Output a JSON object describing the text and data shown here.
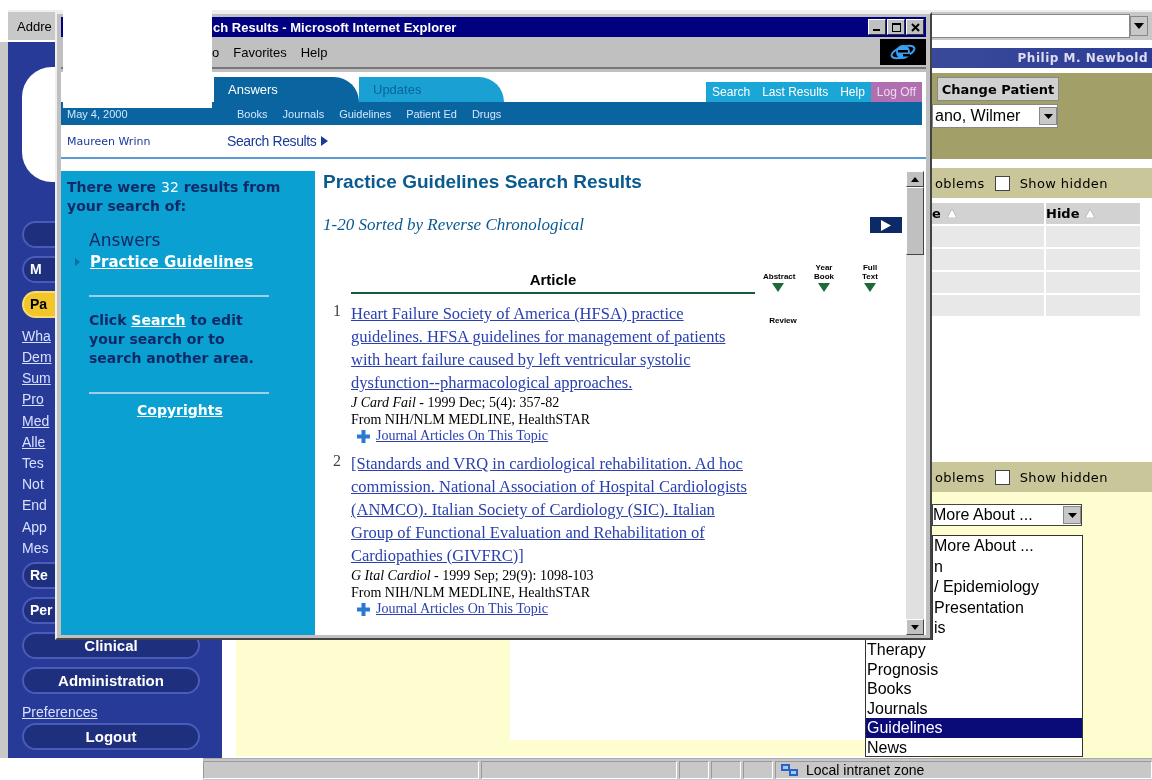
{
  "address_bar": {
    "label": "Addre"
  },
  "sidebar": {
    "items": [
      {
        "kind": "cut-button",
        "selected": false
      },
      {
        "kind": "cut-button",
        "label": "M",
        "selected": false
      },
      {
        "kind": "cut-button",
        "label": "Pa",
        "selected": true
      },
      {
        "kind": "link",
        "label": "Wha"
      },
      {
        "kind": "link",
        "label": "Dem"
      },
      {
        "kind": "link",
        "label": "Sum"
      },
      {
        "kind": "link",
        "label": "Pro"
      },
      {
        "kind": "link",
        "label": "Med"
      },
      {
        "kind": "link",
        "label": "Alle"
      },
      {
        "kind": "text",
        "label": "Tes"
      },
      {
        "kind": "text",
        "label": "Not"
      },
      {
        "kind": "text",
        "label": "End"
      },
      {
        "kind": "text",
        "label": "App"
      },
      {
        "kind": "text",
        "label": "Mes"
      },
      {
        "kind": "cut-button",
        "label": "Re",
        "selected": false
      },
      {
        "kind": "cut-button",
        "label": "Per",
        "selected": false
      },
      {
        "kind": "button",
        "label": "Clinical",
        "selected": false
      },
      {
        "kind": "button",
        "label": "Administration",
        "selected": false
      },
      {
        "kind": "link",
        "label": "Preferences"
      },
      {
        "kind": "button",
        "label": "Logout",
        "selected": false
      }
    ]
  },
  "header": {
    "user": "Philip M. Newbold",
    "change_patient": "Change Patient",
    "patient": "ano, Wilmer"
  },
  "problems_top": {
    "label": "oblems",
    "show_hidden": {
      "label": "Show hidden",
      "checked": false
    },
    "columns": [
      {
        "label": "e"
      },
      {
        "label": "Hide"
      }
    ],
    "row_count_rows": [
      {},
      {},
      {},
      {}
    ]
  },
  "problems_bottom": {
    "label": "oblems",
    "show_hidden": {
      "label": "Show hidden",
      "checked": false
    },
    "select": "More About ...",
    "list_beside_window": [
      {
        "label": "More About ...",
        "selected": false
      },
      {
        "label": "n",
        "selected": false
      },
      {
        "label": "/ Epidemiology",
        "selected": false
      },
      {
        "label": "Presentation",
        "selected": false
      },
      {
        "label": "is",
        "selected": false
      }
    ],
    "list": [
      {
        "label": "Therapy",
        "selected": false
      },
      {
        "label": "Prognosis",
        "selected": false
      },
      {
        "label": "Books",
        "selected": false
      },
      {
        "label": "Journals",
        "selected": false
      },
      {
        "label": "Guidelines",
        "selected": true
      },
      {
        "label": "News",
        "selected": false
      }
    ]
  },
  "status_bar": {
    "zone": "Local intranet zone"
  },
  "ie_window": {
    "title": "ch Results - Microsoft Internet Explorer",
    "menu": [
      "o",
      "Favorites",
      "Help"
    ],
    "tabs": [
      {
        "label": "Answers",
        "selected": true
      },
      {
        "label": "Updates",
        "selected": false
      }
    ],
    "nav": [
      {
        "label": "Search",
        "kind": "normal"
      },
      {
        "label": "Last Results",
        "kind": "normal"
      },
      {
        "label": "Help",
        "kind": "normal"
      },
      {
        "label": "Log Off",
        "kind": "logoff"
      }
    ],
    "date": "May 4, 2000",
    "sections": [
      "Books",
      "Journals",
      "Guidelines",
      "Patient Ed",
      "Drugs"
    ],
    "user": "Maureen Wrinn",
    "breadcrumb": "Search Results",
    "summary": {
      "prefix": "There were",
      "count": "32",
      "suffix": "results from your search of:"
    },
    "area": "Answers",
    "area_link": "Practice Guidelines",
    "hint": {
      "before": "Click",
      "link": "Search",
      "after": "to edit your search or to search another area."
    },
    "copyrights": "Copyrights",
    "heading": "Practice Guidelines Search Results",
    "sort": "1-20 Sorted by Reverse Chronological",
    "column": "Article",
    "icon_columns": [
      "Abstract",
      "Year Book",
      "Full Text"
    ],
    "results": [
      {
        "number": "1",
        "title": "Heart Failure Society of America (HFSA) practice guidelines. HFSA guidelines for management of patients with heart failure caused by left ventricular systolic dysfunction--pharmacological approaches.",
        "citation": "*J Card Fail* - 1999 Dec; 5(4): 357-82",
        "source": "From NIH/NLM MEDLINE, HealthSTAR",
        "related": "Journal Articles On This Topic",
        "abstract": "Review"
      },
      {
        "number": "2",
        "title": "[Standards and VRQ in cardiological rehabilitation. Ad hoc commission. National Association of Hospital Cardiologists (ANMCO). Italian Society of Cardiology (SIC). Italian Group of Functional Evaluation and Rehabilitation of Cardiopathies (GIVFRC)]",
        "citation": "*G Ital Cardiol* - 1999 Sep; 29(9): 1098-103",
        "source": "From NIH/NLM MEDLINE, HealthSTAR",
        "related": "Journal Articles On This Topic"
      }
    ]
  }
}
